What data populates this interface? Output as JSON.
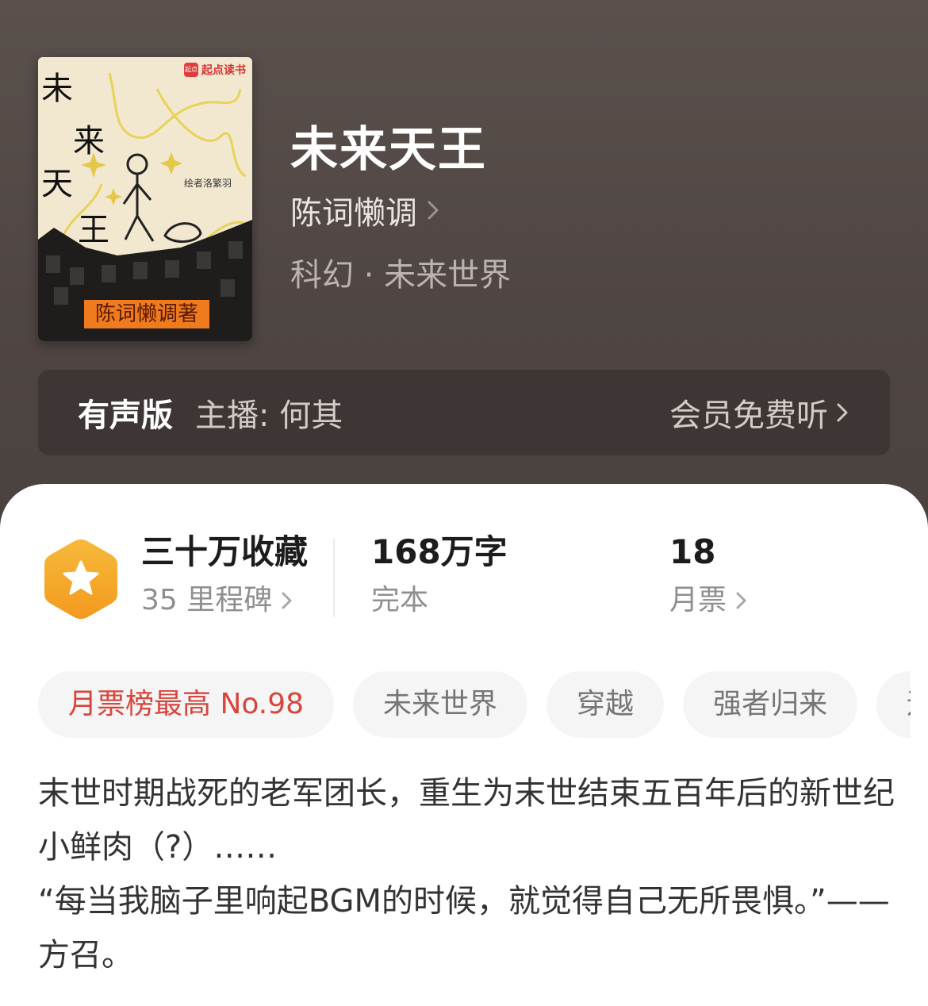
{
  "cover": {
    "brand_badge": "起点",
    "brand_name": "起点读书",
    "title_chars": [
      "未",
      "来",
      "天",
      "王"
    ],
    "subtitle": "绘者洛繁羽",
    "author_label": "陈词懒调著"
  },
  "book": {
    "title": "未来天王",
    "author": "陈词懒调",
    "category": "科幻 · 未来世界"
  },
  "audio": {
    "label": "有声版",
    "anchor": "主播: 何其",
    "free_listen": "会员免费听"
  },
  "stats": {
    "collections": "三十万收藏",
    "milestones": "35 里程碑",
    "word_count": "168万字",
    "status": "完本",
    "monthly_tickets_count": "18",
    "monthly_tickets_label": "月票"
  },
  "tags": [
    "月票榜最高 No.98",
    "未来世界",
    "穿越",
    "强者归来",
    "运"
  ],
  "description": {
    "line1": "末世时期战死的老军团长，重生为末世结束五百年后的新世纪小鲜肉（?）……",
    "line2": "“每当我脑子里响起BGM的时候，就觉得自己无所畏惧。”——方召。"
  },
  "colors": {
    "header_bg": "#4f4643",
    "tag_highlight": "#d9443c",
    "badge_orange": "#f5a524"
  }
}
